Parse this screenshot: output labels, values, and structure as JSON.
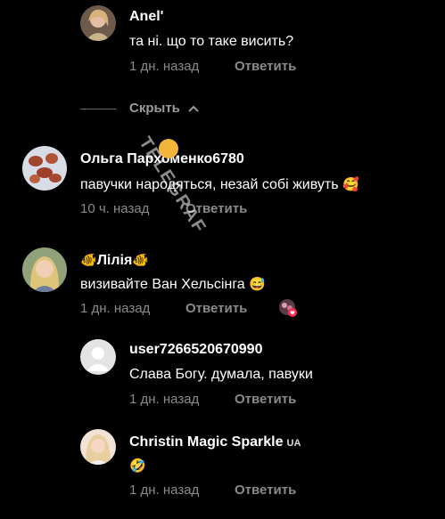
{
  "comments": [
    {
      "name": "Anel'",
      "text": "та ні. що то таке висить?",
      "time": "1 дн. назад",
      "reply": "Ответить"
    },
    {
      "name": "Ольга Пархоменко6780",
      "text": "павучки народяться, незай собі живуть",
      "emoji": "🥰",
      "time": "10 ч. назад",
      "reply": "Ответить"
    },
    {
      "name": "Лілія",
      "name_emoji": "🐠",
      "text": "визивайте Ван Хельсінга",
      "emoji": "😅",
      "time": "1 дн. назад",
      "reply": "Ответить"
    },
    {
      "name": "user7266520670990",
      "text": "Слава Богу. думала, павуки",
      "time": "1 дн. назад",
      "reply": "Ответить"
    },
    {
      "name": "Christin Magic Sparkle",
      "badge": "UA",
      "text": "",
      "emoji": "🤣",
      "time": "1 дн. назад",
      "reply": "Ответить"
    }
  ],
  "hide_label": "Скрыть",
  "watermark": "TELEGRAF"
}
